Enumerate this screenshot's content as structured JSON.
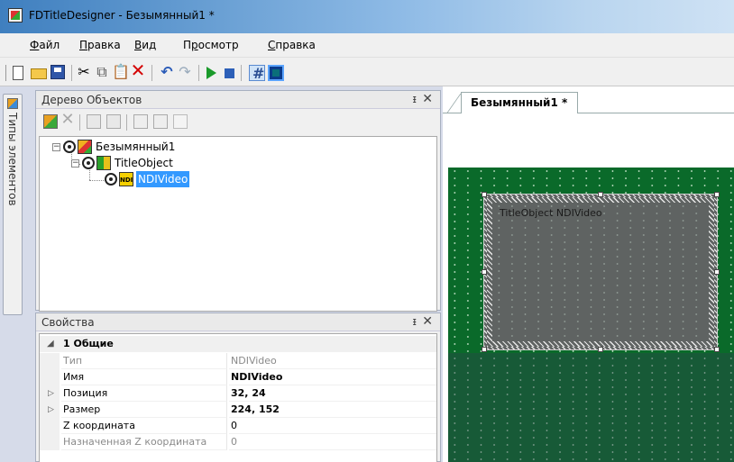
{
  "window": {
    "title": "FDTitleDesigner - Безымянный1 *"
  },
  "menu": [
    {
      "label": "Файл",
      "key": "Ф",
      "rest": "айл"
    },
    {
      "label": "Правка",
      "key": "П",
      "rest": "равка"
    },
    {
      "label": "Вид",
      "key": "В",
      "rest": "ид"
    },
    {
      "label": "Просмотр",
      "key": "р",
      "pre": "П",
      "rest": "осмотр"
    },
    {
      "label": "Справка",
      "key": "С",
      "rest": "правка"
    }
  ],
  "toolbar": {
    "icons": [
      "new-icon",
      "open-icon",
      "save-icon",
      "cut-icon",
      "copy-icon",
      "paste-icon",
      "delete-icon",
      "undo-icon",
      "redo-icon",
      "play-icon",
      "stop-icon",
      "grid-icon",
      "frame-icon"
    ]
  },
  "left_strip": {
    "tab_label": "Типы элементов"
  },
  "tree_panel": {
    "title": "Дерево Объектов",
    "pin": "ᵻ",
    "close": "✕",
    "nodes": [
      {
        "label": "Безымянный1",
        "icon": "project-icon",
        "expanded": true
      },
      {
        "label": "TitleObject",
        "icon": "title-object-icon",
        "expanded": true
      },
      {
        "label": "NDIVideo",
        "icon": "ndi-icon",
        "selected": true,
        "icon_text": "NDI"
      }
    ]
  },
  "props_panel": {
    "title": "Свойства",
    "pin": "ᵻ",
    "close": "✕",
    "category": "1 Общие",
    "rows": [
      {
        "name": "Тип",
        "value": "NDIVideo",
        "style": "grey"
      },
      {
        "name": "Имя",
        "value": "NDIVideo",
        "style": "bold"
      },
      {
        "name": "Позиция",
        "value": "32, 24",
        "style": "bold",
        "expandable": true
      },
      {
        "name": "Размер",
        "value": "224, 152",
        "style": "bold",
        "expandable": true
      },
      {
        "name": "Z координата",
        "value": "0",
        "style": "normal"
      },
      {
        "name": "Назначенная Z координата",
        "value": "0",
        "style": "grey"
      }
    ]
  },
  "document": {
    "tab_label": "Безымянный1 *",
    "object_label": "TitleObject NDIVideo"
  }
}
